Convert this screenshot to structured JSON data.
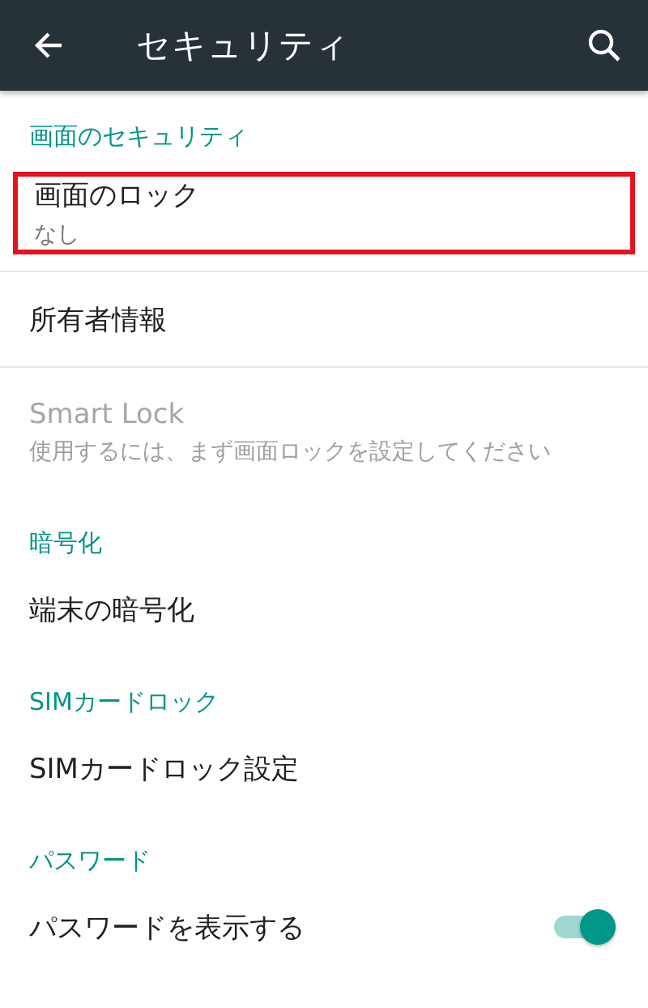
{
  "app_bar": {
    "title": "セキュリティ"
  },
  "sections": [
    {
      "header": "画面のセキュリティ",
      "items": [
        {
          "kind": "text",
          "title": "画面のロック",
          "subtitle": "なし",
          "disabled": false,
          "highlighted": true
        },
        {
          "kind": "text",
          "title": "所有者情報",
          "disabled": false,
          "highlighted": false
        },
        {
          "kind": "text",
          "title": "Smart Lock",
          "subtitle": "使用するには、まず画面ロックを設定してください",
          "disabled": true,
          "highlighted": false
        }
      ]
    },
    {
      "header": "暗号化",
      "items": [
        {
          "kind": "text",
          "title": "端末の暗号化",
          "disabled": false,
          "highlighted": false
        }
      ]
    },
    {
      "header": "SIMカードロック",
      "items": [
        {
          "kind": "text",
          "title": "SIMカードロック設定",
          "disabled": false,
          "highlighted": false
        }
      ]
    },
    {
      "header": "パスワード",
      "items": [
        {
          "kind": "switch",
          "title": "パスワードを表示する",
          "on": true,
          "disabled": false,
          "highlighted": false
        }
      ]
    }
  ]
}
